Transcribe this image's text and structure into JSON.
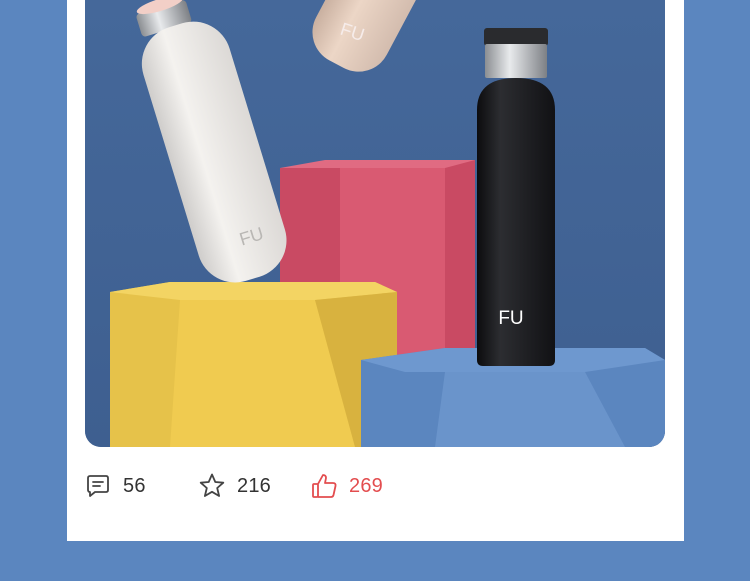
{
  "post": {
    "image": {
      "subject": "product-photo-fu-bottles",
      "logo_text": "FU"
    },
    "actions": {
      "comments": {
        "icon": "comment-icon",
        "count": "56"
      },
      "favorites": {
        "icon": "star-icon",
        "count": "216"
      },
      "likes": {
        "icon": "thumbs-up-icon",
        "count": "269",
        "active": true
      }
    }
  },
  "colors": {
    "page_background": "#5b86bf",
    "card_background": "#ffffff",
    "count_text": "#333333",
    "like_active": "#e34d4f"
  }
}
